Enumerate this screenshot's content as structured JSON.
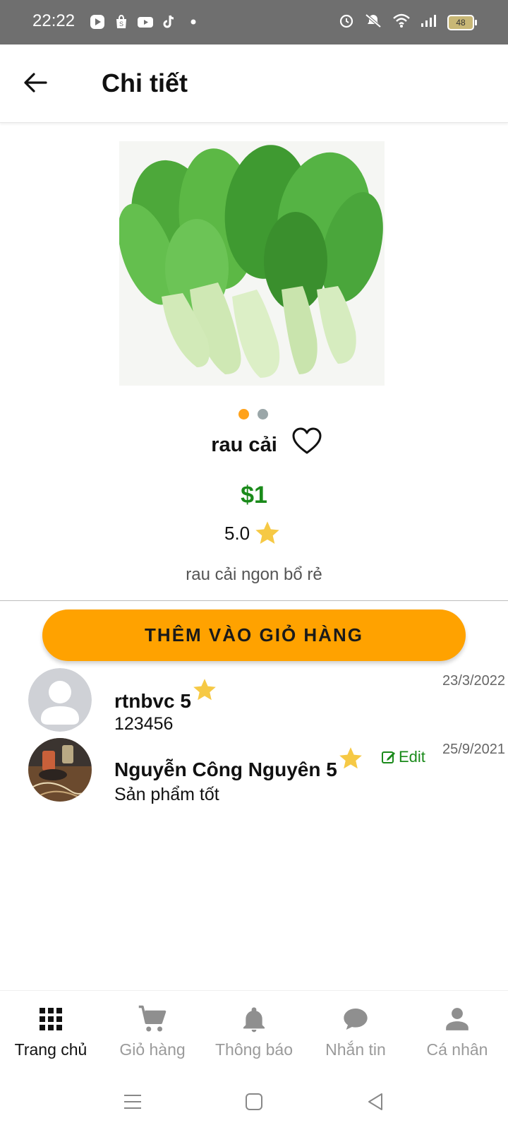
{
  "status_bar": {
    "time": "22:22",
    "battery": "48"
  },
  "header": {
    "title": "Chi tiết"
  },
  "product": {
    "name": "rau cải",
    "price": "$1",
    "rating": "5.0",
    "description": "rau cải ngon bổ rẻ",
    "carousel_pages": 2,
    "carousel_active_index": 0,
    "add_to_cart_label": "THÊM VÀO GIỎ HÀNG"
  },
  "reviews": [
    {
      "name": "rtnbvc 5",
      "stars": 5,
      "date": "23/3/2022",
      "text": "123456",
      "avatar": "default-avatar-icon"
    },
    {
      "name": "Nguyễn Công Nguyên 5",
      "stars": 5,
      "date": "25/9/2021",
      "text": "Sản phẩm tốt",
      "avatar": "photo",
      "edit_label": "Edit"
    }
  ],
  "bottom_nav": {
    "items": [
      {
        "label": "Trang chủ",
        "icon": "grid-icon",
        "active": true
      },
      {
        "label": "Giỏ hàng",
        "icon": "cart-icon",
        "active": false
      },
      {
        "label": "Thông báo",
        "icon": "bell-icon",
        "active": false
      },
      {
        "label": "Nhắn tin",
        "icon": "chat-icon",
        "active": false
      },
      {
        "label": "Cá nhân",
        "icon": "person-icon",
        "active": false
      }
    ]
  },
  "colors": {
    "accent": "#ffa200",
    "price": "#1a8a1a",
    "star": "#f6c945",
    "status_bar": "#6f6f6f"
  }
}
